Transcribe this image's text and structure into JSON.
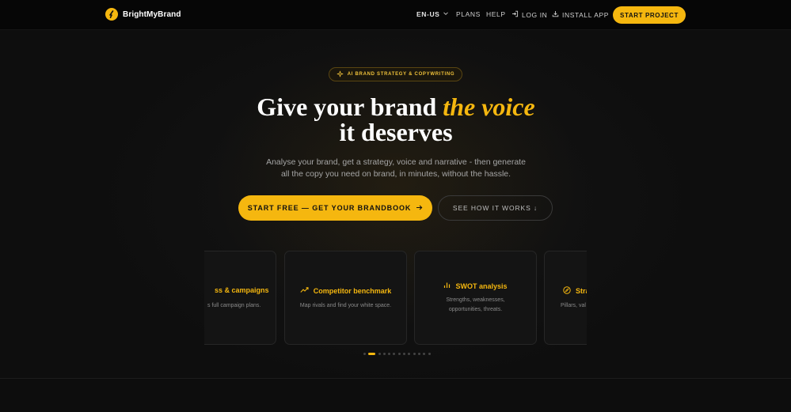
{
  "brand": {
    "name": "BrightMyBrand",
    "accent": "#f5b70f",
    "icon": "bolt-icon"
  },
  "nav": {
    "language": "EN-US",
    "plans": "PLANS",
    "help": "HELP",
    "login": "LOG IN",
    "install": "INSTALL APP",
    "cta": "START PROJECT"
  },
  "hero": {
    "badge": "AI BRAND STRATEGY & COPYWRITING",
    "headline_part1": "Give your brand ",
    "headline_accent": "the voice",
    "headline_part2": "it deserves",
    "subtitle_line1": "Analyse your brand, get a strategy, voice and narrative - then generate",
    "subtitle_line2": "all the copy you need on brand, in minutes, without the hassle.",
    "primary_cta": "START FREE — GET YOUR BRANDBOOK",
    "secondary_cta": "SEE HOW IT WORKS ↓"
  },
  "features": [
    {
      "title": "ss & campaigns",
      "desc_line1": "s full campaign plans.",
      "desc_line2": "",
      "icon": "megaphone-icon"
    },
    {
      "title": "Competitor benchmark",
      "desc_line1": "Map rivals and find your white space.",
      "desc_line2": "",
      "icon": "trend-up-icon"
    },
    {
      "title": "SWOT analysis",
      "desc_line1": "Strengths, weaknesses,",
      "desc_line2": "opportunities, threats.",
      "icon": "bar-chart-icon"
    },
    {
      "title": "Stra",
      "desc_line1": "Pillars, val",
      "desc_line2": "",
      "icon": "compass-icon"
    }
  ],
  "carousel": {
    "total_dots": 13,
    "active_index": 1
  }
}
